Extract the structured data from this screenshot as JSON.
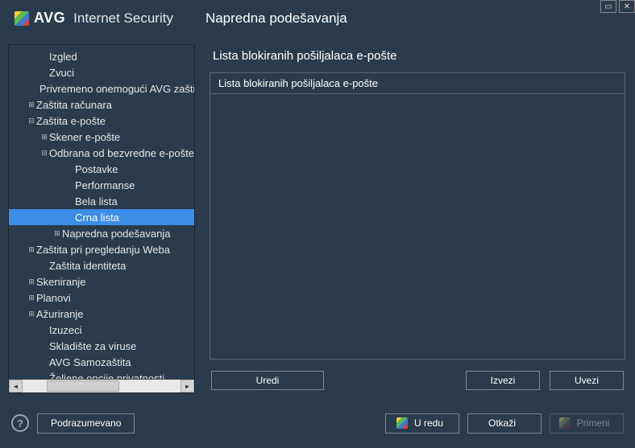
{
  "app": {
    "brand": "AVG",
    "suffix": "Internet Security",
    "title": "Napredna podešavanja"
  },
  "tree": [
    {
      "key": "izgled",
      "label": "Izgled",
      "indent": 2,
      "expander": ""
    },
    {
      "key": "zvuci",
      "label": "Zvuci",
      "indent": 2,
      "expander": ""
    },
    {
      "key": "privremeno",
      "label": "Privremeno onemogući AVG zaštitu",
      "indent": 2,
      "expander": ""
    },
    {
      "key": "zastita-racunara",
      "label": "Zaštita računara",
      "indent": 1,
      "expander": "⊞"
    },
    {
      "key": "zastita-eposte",
      "label": "Zaštita e-pošte",
      "indent": 1,
      "expander": "⊟"
    },
    {
      "key": "skener-eposte",
      "label": "Skener e-pošte",
      "indent": 2,
      "expander": "⊞"
    },
    {
      "key": "odbrana",
      "label": "Odbrana od bezvredne e-pošte",
      "indent": 2,
      "expander": "⊟"
    },
    {
      "key": "postavke",
      "label": "Postavke",
      "indent": 4,
      "expander": ""
    },
    {
      "key": "performanse",
      "label": "Performanse",
      "indent": 4,
      "expander": ""
    },
    {
      "key": "bela-lista",
      "label": "Bela lista",
      "indent": 4,
      "expander": ""
    },
    {
      "key": "crna-lista",
      "label": "Crna lista",
      "indent": 4,
      "expander": "",
      "selected": true
    },
    {
      "key": "napredna-sub",
      "label": "Napredna podešavanja",
      "indent": 3,
      "expander": "⊞"
    },
    {
      "key": "zastita-web",
      "label": "Zaštita pri pregledanju Weba",
      "indent": 1,
      "expander": "⊞"
    },
    {
      "key": "zastita-identiteta",
      "label": "Zaštita identiteta",
      "indent": 2,
      "expander": ""
    },
    {
      "key": "skeniranje",
      "label": "Skeniranje",
      "indent": 1,
      "expander": "⊞"
    },
    {
      "key": "planovi",
      "label": "Planovi",
      "indent": 1,
      "expander": "⊞"
    },
    {
      "key": "azuriranje",
      "label": "Ažuriranje",
      "indent": 1,
      "expander": "⊞"
    },
    {
      "key": "izuzeci",
      "label": "Izuzeci",
      "indent": 2,
      "expander": ""
    },
    {
      "key": "skladiste",
      "label": "Skladište za viruse",
      "indent": 2,
      "expander": ""
    },
    {
      "key": "samozastita",
      "label": "AVG Samozaštita",
      "indent": 2,
      "expander": ""
    },
    {
      "key": "zeljene",
      "label": "Željene opcije privatnosti",
      "indent": 2,
      "expander": ""
    }
  ],
  "content": {
    "heading": "Lista blokiranih pošiljalaca e-pošte",
    "list_header": "Lista blokiranih pošiljalaca e-pošte",
    "buttons": {
      "edit": "Uredi",
      "export": "Izvezi",
      "import": "Uvezi"
    }
  },
  "footer": {
    "defaults": "Podrazumevano",
    "ok": "U redu",
    "cancel": "Otkaži",
    "apply": "Primeni"
  }
}
